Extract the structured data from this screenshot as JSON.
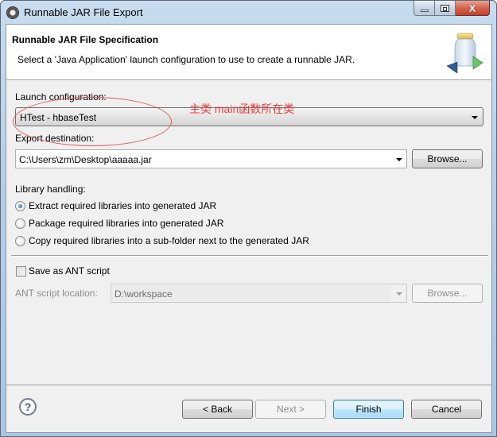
{
  "window": {
    "title": "Runnable JAR File Export",
    "icon": "eclipse-gear-icon",
    "controls": {
      "minimize": "minimize-icon",
      "maximize": "maximize-icon",
      "close": "close-icon",
      "close_glyph": "X"
    }
  },
  "header": {
    "title": "Runnable JAR File Specification",
    "description": "Select a 'Java Application' launch configuration to use to create a runnable JAR.",
    "icon": "jar-export-wizard-icon"
  },
  "launch_configuration": {
    "label": "Launch configuration:",
    "value": "HTest - hbaseTest"
  },
  "export_destination": {
    "label": "Export destination:",
    "value": "C:\\Users\\zm\\Desktop\\aaaaa.jar",
    "browse_label": "Browse..."
  },
  "library_handling": {
    "label": "Library handling:",
    "options": [
      {
        "label": "Extract required libraries into generated JAR",
        "selected": true
      },
      {
        "label": "Package required libraries into generated JAR",
        "selected": false
      },
      {
        "label": "Copy required libraries into a sub-folder next to the generated JAR",
        "selected": false
      }
    ]
  },
  "ant": {
    "save_label": "Save as ANT script",
    "save_checked": false,
    "location_label": "ANT script location:",
    "location_value": "D:\\workspace",
    "browse_label": "Browse..."
  },
  "annotation": {
    "text": "主类 main函数所在类",
    "color": "#f03a3a"
  },
  "footer": {
    "help_glyph": "?",
    "back_label": "< Back",
    "next_label": "Next >",
    "finish_label": "Finish",
    "cancel_label": "Cancel"
  }
}
